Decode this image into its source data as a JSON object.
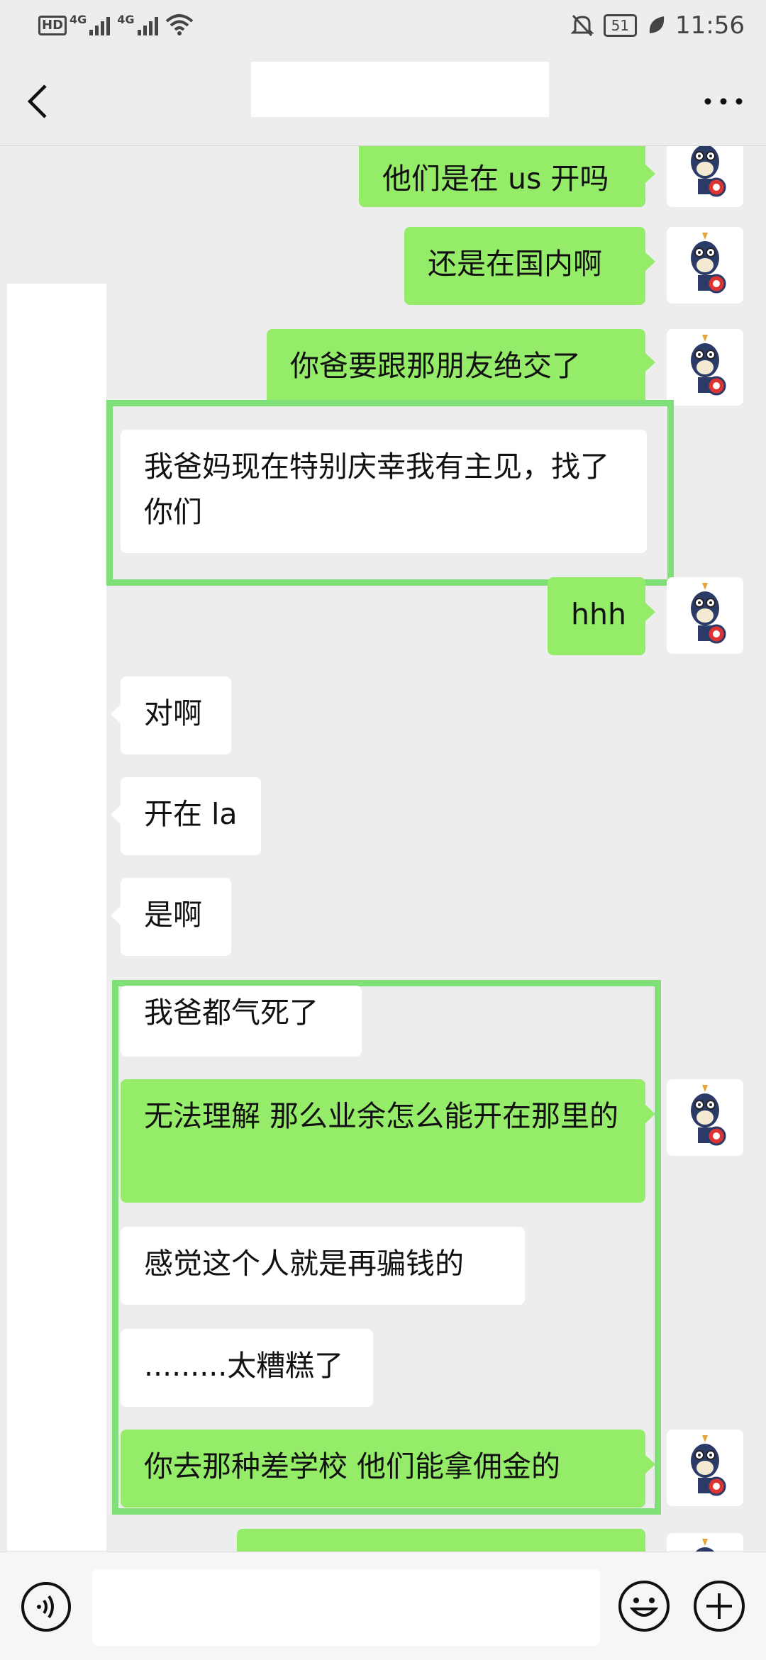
{
  "status_bar": {
    "network_left": "HD",
    "sim1": "4G",
    "sim2": "4G",
    "battery": "51",
    "time": "11:56"
  },
  "header": {
    "title": ""
  },
  "messages": [
    {
      "id": "m1",
      "side": "me",
      "text": "他们是在 us 开吗"
    },
    {
      "id": "m2",
      "side": "me",
      "text": "还是在国内啊"
    },
    {
      "id": "m3",
      "side": "me",
      "text": "你爸要跟那朋友绝交了"
    },
    {
      "id": "m4",
      "side": "them",
      "text": "我爸妈现在特别庆幸我有主见，找了你们"
    },
    {
      "id": "m5",
      "side": "me",
      "text": "hhh"
    },
    {
      "id": "m6",
      "side": "them",
      "text": "对啊"
    },
    {
      "id": "m7",
      "side": "them",
      "text": "开在 la"
    },
    {
      "id": "m8",
      "side": "them",
      "text": "是啊"
    },
    {
      "id": "m9",
      "side": "them",
      "text": "我爸都气死了"
    },
    {
      "id": "m10",
      "side": "me",
      "text": "无法理解 那么业余怎么能开在那里的"
    },
    {
      "id": "m11",
      "side": "them",
      "text": "感觉这个人就是再骗钱的"
    },
    {
      "id": "m12",
      "side": "them",
      "text": ".........太糟糕了"
    },
    {
      "id": "m13",
      "side": "me",
      "text": "你去那种差学校  他们能拿佣金的"
    },
    {
      "id": "m14",
      "side": "me",
      "text": ""
    }
  ],
  "colors": {
    "my_bubble": "#95ec69",
    "their_bubble": "#ffffff",
    "background": "#ededed",
    "highlight": "#7fe07a"
  },
  "icons": [
    "back-icon",
    "more-icon",
    "voice-icon",
    "emoji-icon",
    "plus-icon",
    "bell-off-icon",
    "wifi-icon",
    "leaf-icon"
  ]
}
